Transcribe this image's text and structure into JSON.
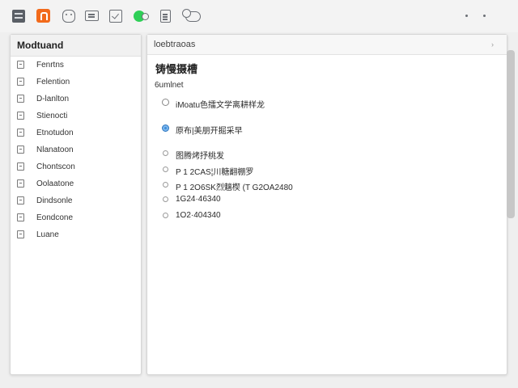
{
  "toolbar": {
    "icons": [
      "grid-icon",
      "app-icon",
      "face-icon",
      "screen-icon",
      "check-icon",
      "status-icon",
      "document-icon",
      "chat-icon",
      "dot-icon",
      "dot-icon"
    ],
    "accent": "#f26a1b",
    "status_color": "#2fcf57"
  },
  "sidebar": {
    "title": "Modtuand",
    "items": [
      {
        "label": "Fenrtns"
      },
      {
        "label": "Felention"
      },
      {
        "label": "D-lanlton"
      },
      {
        "label": "Stienocti"
      },
      {
        "label": "Etnotudon"
      },
      {
        "label": "Nlanatoon"
      },
      {
        "label": "Chontscon"
      },
      {
        "label": "Oolaatone"
      },
      {
        "label": "Dindsonle"
      },
      {
        "label": "Eondcone"
      },
      {
        "label": "Luane"
      }
    ]
  },
  "main": {
    "breadcrumb": "loebtraoas",
    "chevron": "›",
    "section_title": "铸慢摄槽",
    "section_subtitle": "6umlnet",
    "options": [
      {
        "label": "iMoatu色擂文学离耕样龙",
        "checked": false
      },
      {
        "label": "原布|美朋开掘采早",
        "checked": true
      },
      {
        "label": "图腾烤抒桃发",
        "checked": false
      },
      {
        "label": "P 1 2CAS¦川糖翻棚罗",
        "checked": false
      },
      {
        "label": "P 1 2O6SK烈魑楔    (T G2OA2480",
        "checked": false
      },
      {
        "label": "1G24·46340",
        "checked": false
      },
      {
        "label": "1O2·404340",
        "checked": false
      }
    ]
  },
  "colors": {
    "radio_selected": "#3b8ddb"
  }
}
